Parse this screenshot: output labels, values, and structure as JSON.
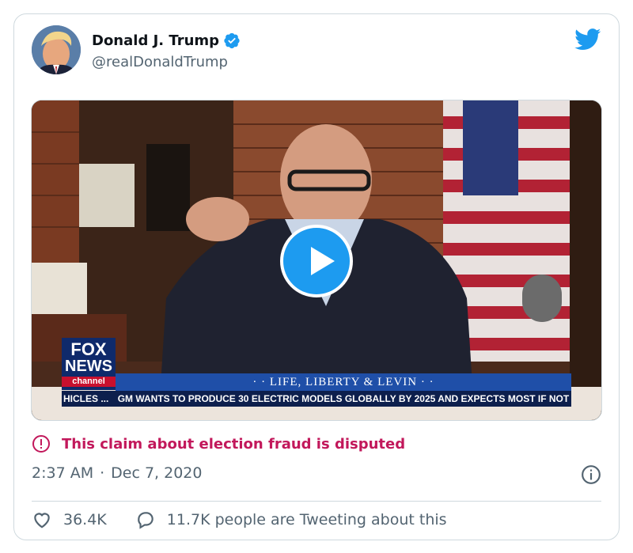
{
  "author": {
    "name": "Donald J. Trump",
    "handle": "@realDonaldTrump"
  },
  "media": {
    "network_logo_line1": "FOX",
    "network_logo_line2": "NEWS",
    "network_logo_line3": "channel",
    "show_banner": "· · LIFE, LIBERTY & LEVIN · ·",
    "ticker_prefix": "HICLES ...",
    "ticker_text": "GM WANTS TO PRODUCE 30 ELECTRIC MODELS GLOBALLY BY 2025 AND EXPECTS MOST IF NOT"
  },
  "warning": {
    "text": "This claim about election fraud is disputed",
    "color": "#c2185b"
  },
  "timestamp": {
    "time": "2:37 AM",
    "separator": "·",
    "date": "Dec 7, 2020"
  },
  "actions": {
    "likes": "36.4K",
    "replies_text": "11.7K people are Tweeting about this"
  },
  "colors": {
    "brand_blue": "#1d9bf0",
    "muted_text": "#536471",
    "border": "#cfd9de"
  },
  "icons": {
    "verified": "verified-badge-icon",
    "bird": "twitter-bird-icon",
    "play": "play-icon",
    "warning": "exclamation-circle-icon",
    "info": "info-icon",
    "like": "heart-icon",
    "reply": "speech-bubble-icon"
  }
}
